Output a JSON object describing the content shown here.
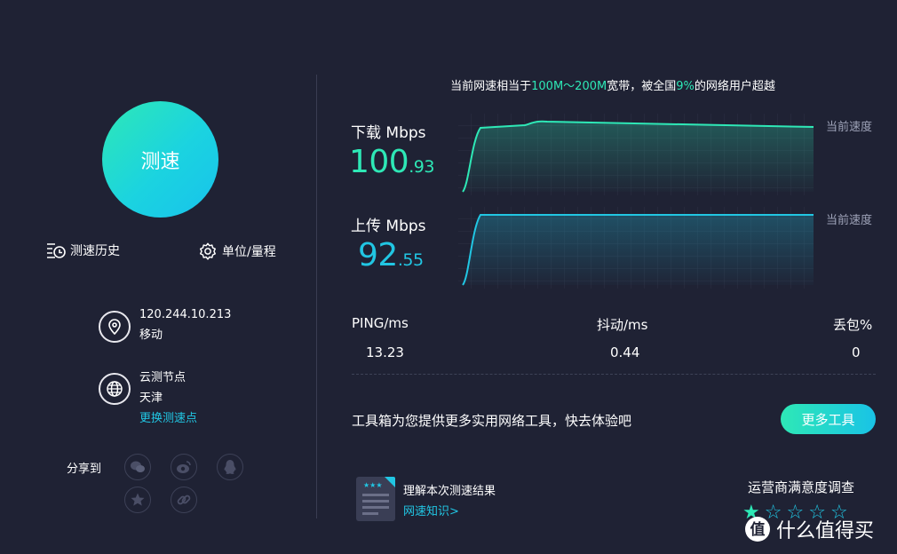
{
  "left": {
    "speed_button": "测速",
    "history_label": "测速历史",
    "unit_label": "单位/量程",
    "ip_address": "120.244.10.213",
    "isp": "移动",
    "node_title": "云测节点",
    "node_city": "天津",
    "change_node": "更换测速点",
    "share_label": "分享到"
  },
  "headline": {
    "prefix": "当前网速相当于",
    "bandwidth": "100M～200M",
    "middle": "宽带，被全国",
    "percent": "9%",
    "suffix": "的网络用户超越"
  },
  "download": {
    "label": "下载 Mbps",
    "int": "100",
    "dec": ".93",
    "current_label": "当前速度",
    "level": 0.93
  },
  "upload": {
    "label": "上传 Mbps",
    "int": "92",
    "dec": ".55",
    "current_label": "当前速度",
    "level": 0.95
  },
  "stats": [
    {
      "label": "PING/ms",
      "value": "13.23"
    },
    {
      "label": "抖动/ms",
      "value": "0.44"
    },
    {
      "label": "丢包%",
      "value": "0"
    }
  ],
  "tools": {
    "text": "工具箱为您提供更多实用网络工具，快去体验吧",
    "button": "更多工具"
  },
  "knowledge": {
    "title": "理解本次测速结果",
    "link": "网速知识>"
  },
  "survey": {
    "title": "运营商满意度调查",
    "stars_filled": 1,
    "stars_total": 5
  },
  "watermark": "什么值得买",
  "colors": {
    "background": "#1f2234",
    "download": "#2ee8b6",
    "upload": "#21c6e3"
  }
}
